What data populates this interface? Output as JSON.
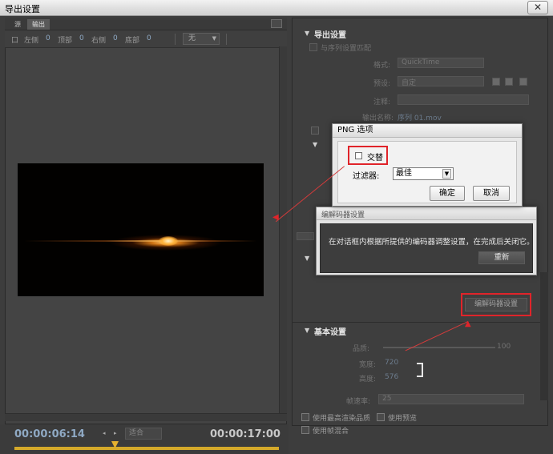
{
  "window": {
    "title": "导出设置",
    "close_glyph": "✕"
  },
  "source": {
    "tabs": [
      "源",
      "输出"
    ],
    "crop": [
      {
        "label": "左侧",
        "value": "0"
      },
      {
        "label": "顶部",
        "value": "0"
      },
      {
        "label": "右侧",
        "value": "0"
      },
      {
        "label": "底部",
        "value": "0"
      }
    ],
    "crop_prefix": "口",
    "aspect_select": "无"
  },
  "timeline": {
    "current_time": "00:00:06:14",
    "total_time": "00:00:17:00",
    "fit_select": "适合",
    "track_color": "#d4a92a"
  },
  "export_settings": {
    "header": "导出设置",
    "match_sequence": "与序列设置匹配",
    "rows": [
      {
        "label": "格式:",
        "value": "QuickTime"
      },
      {
        "label": "预设:",
        "value": "自定"
      },
      {
        "label": "注释:",
        "value": ""
      },
      {
        "label": "输出名称:",
        "value": "序列 01.mov"
      }
    ],
    "encoder_button": "编解码器设置",
    "basic_header": "基本设置",
    "basic_rows": [
      {
        "label": "品质:",
        "value": "100"
      },
      {
        "label": "宽度:",
        "value": "720"
      },
      {
        "label": "高度:",
        "value": "576"
      },
      {
        "label": "帧速率:",
        "value": "25"
      }
    ],
    "bottom_checks": [
      {
        "label": "使用最高渲染品质"
      },
      {
        "label": "使用预览"
      },
      {
        "label": "使用帧混合"
      }
    ]
  },
  "png_dialog": {
    "title": "PNG 选项",
    "interlace_label": "交替",
    "filter_label": "过滤器:",
    "filter_value": "最佳",
    "ok": "确定",
    "cancel": "取消"
  },
  "encoder_dialog": {
    "title": "编解码器设置",
    "message": "在对话框内根据所提供的编码器调整设置，在完成后关闭它。",
    "reset": "重新"
  },
  "annotation_color": "#e0242a"
}
